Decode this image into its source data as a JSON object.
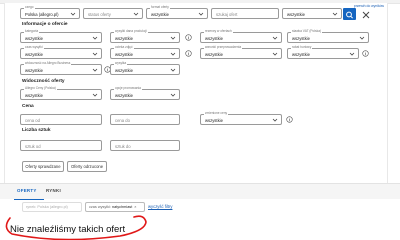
{
  "search_row": {
    "category": {
      "label": "czego",
      "value": "Polska (allegro.pl)"
    },
    "status": {
      "label": "",
      "value": "status oferty"
    },
    "format": {
      "label": "format oferty",
      "value": "wszystkie"
    },
    "search": {
      "placeholder": "szukaj ofert"
    },
    "scope": {
      "value": "wszystkie"
    },
    "scroll_link": "przewiń do wyników"
  },
  "offer_info": {
    "title": "Informacje o ofercie",
    "fields": [
      {
        "label": "kategoria",
        "value": "wszystkie"
      },
      {
        "label": "wysyłki dana produkcji",
        "value": "wszystkie"
      },
      {
        "label": "rezerwy w ofertach",
        "value": "wszystkie"
      },
      {
        "label": "stawka VAT (Polska)",
        "value": "wszystkie"
      },
      {
        "label": "czas wysyłki",
        "value": "wszystkie"
      },
      {
        "label": "ocieka zdjęć",
        "value": "wszystkie"
      },
      {
        "label": "warunki przeprowadzenia",
        "value": "wszystkie"
      },
      {
        "label": "rabat hurtowy",
        "value": "wszystkie"
      },
      {
        "label": "widoczność na Allegro Business",
        "value": "wszystkie"
      },
      {
        "label": "wysyłka",
        "value": "wszystkie"
      }
    ]
  },
  "visibility": {
    "title": "Widoczność oferty",
    "fields": [
      {
        "label": "Allegro Ceny (Polska)",
        "value": "wszystkie"
      },
      {
        "label": "opcje promowania",
        "value": "wszystkie"
      }
    ]
  },
  "price": {
    "title": "Cena",
    "from_placeholder": "cena od",
    "to_placeholder": "cena do",
    "change": {
      "label": "zmienione ceny",
      "value": "wszystkie"
    }
  },
  "quantity": {
    "title": "Liczba sztuk",
    "from_placeholder": "sztuk od",
    "to_placeholder": "sztuk do"
  },
  "buttons": {
    "checked": "Oferty sprawdzane",
    "rejected": "Oferty odrzucone"
  },
  "tabs": {
    "offers": "OFERTY",
    "markets": "RYNKI"
  },
  "chips": {
    "market": "rynek: Polska (allegro.pl)",
    "shipping_prefix": "czas wysyłki: ",
    "shipping_value": "natychmiast",
    "close": "×",
    "clear": "wyczyść filtry"
  },
  "results": {
    "empty": "Nie znaleźliśmy takich ofert"
  },
  "colors": {
    "accent": "#1565c0",
    "annotation": "#e01818"
  }
}
